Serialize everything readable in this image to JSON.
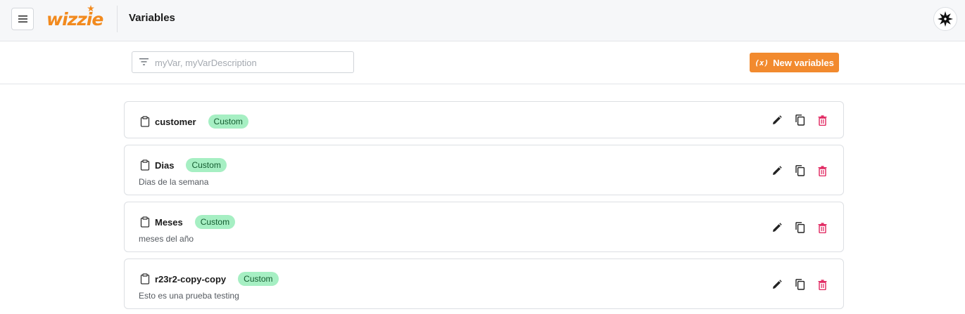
{
  "header": {
    "logo_text": "wizzie",
    "title": "Variables",
    "menu_icon": "hamburger-icon",
    "avatar_icon": "asterisk-logo-icon"
  },
  "toolbar": {
    "search": {
      "placeholder": "myVar, myVarDescription",
      "value": ""
    },
    "new_button": {
      "icon": "(x)",
      "label": "New variables"
    }
  },
  "variables": [
    {
      "name": "customer",
      "badge": "Custom",
      "description": ""
    },
    {
      "name": "Dias",
      "badge": "Custom",
      "description": "Dias de la semana"
    },
    {
      "name": "Meses",
      "badge": "Custom",
      "description": "meses del año"
    },
    {
      "name": "r23r2-copy-copy",
      "badge": "Custom",
      "description": "Esto es una prueba testing"
    }
  ],
  "colors": {
    "accent": "#f28a2e",
    "badge_bg": "#a6efc3",
    "delete": "#e0245e"
  }
}
